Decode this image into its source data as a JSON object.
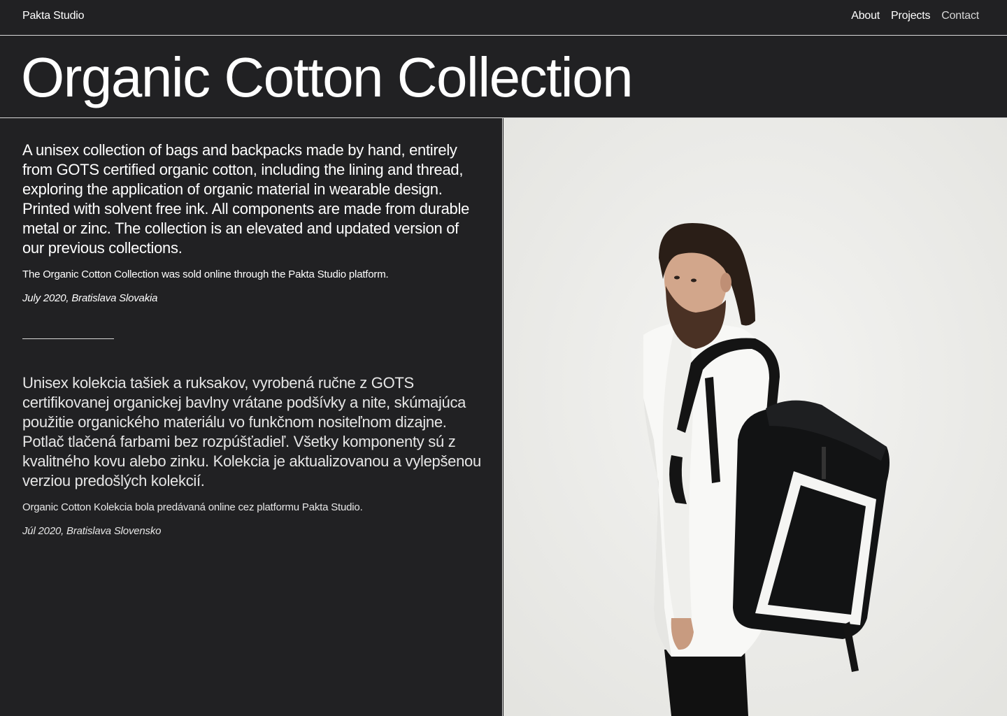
{
  "header": {
    "brand": "Pakta Studio",
    "nav": [
      {
        "label": "About"
      },
      {
        "label": "Projects"
      },
      {
        "label": "Contact"
      }
    ]
  },
  "project": {
    "title": "Organic Cotton Collection",
    "english": {
      "description": "A unisex collection of bags and backpacks made by hand, entirely from GOTS certified organic cotton, including the lining and thread, exploring the application of organic material in wearable design. Printed with solvent free ink. All components are made from durable metal or zinc. The collection is an elevated and updated version of our previous collections.",
      "note": "The Organic Cotton Collection was sold online through the Pakta Studio platform.",
      "date": "July 2020, Bratislava Slovakia"
    },
    "slovak": {
      "description": "Unisex kolekcia tašiek a ruksakov, vyrobená ručne z GOTS certifikovanej organickej bavlny vrátane podšívky a nite, skúmajúca použitie organického materiálu vo funkčnom nositeľnom dizajne. Potlač tlačená farbami bez rozpúšťadieľ. Všetky komponenty sú z kvalitného kovu alebo zinku. Kolekcia je aktualizovanou a vylepšenou verziou predošlých kolekcií.",
      "note": "Organic Cotton Kolekcia bola predávaná online cez platformu Pakta Studio.",
      "date": "Júl 2020, Bratislava Slovensko"
    }
  },
  "colors": {
    "background": "#212123",
    "text": "#ffffff",
    "rule": "#d8d8d8",
    "photo_background": "#eeeeeb"
  }
}
